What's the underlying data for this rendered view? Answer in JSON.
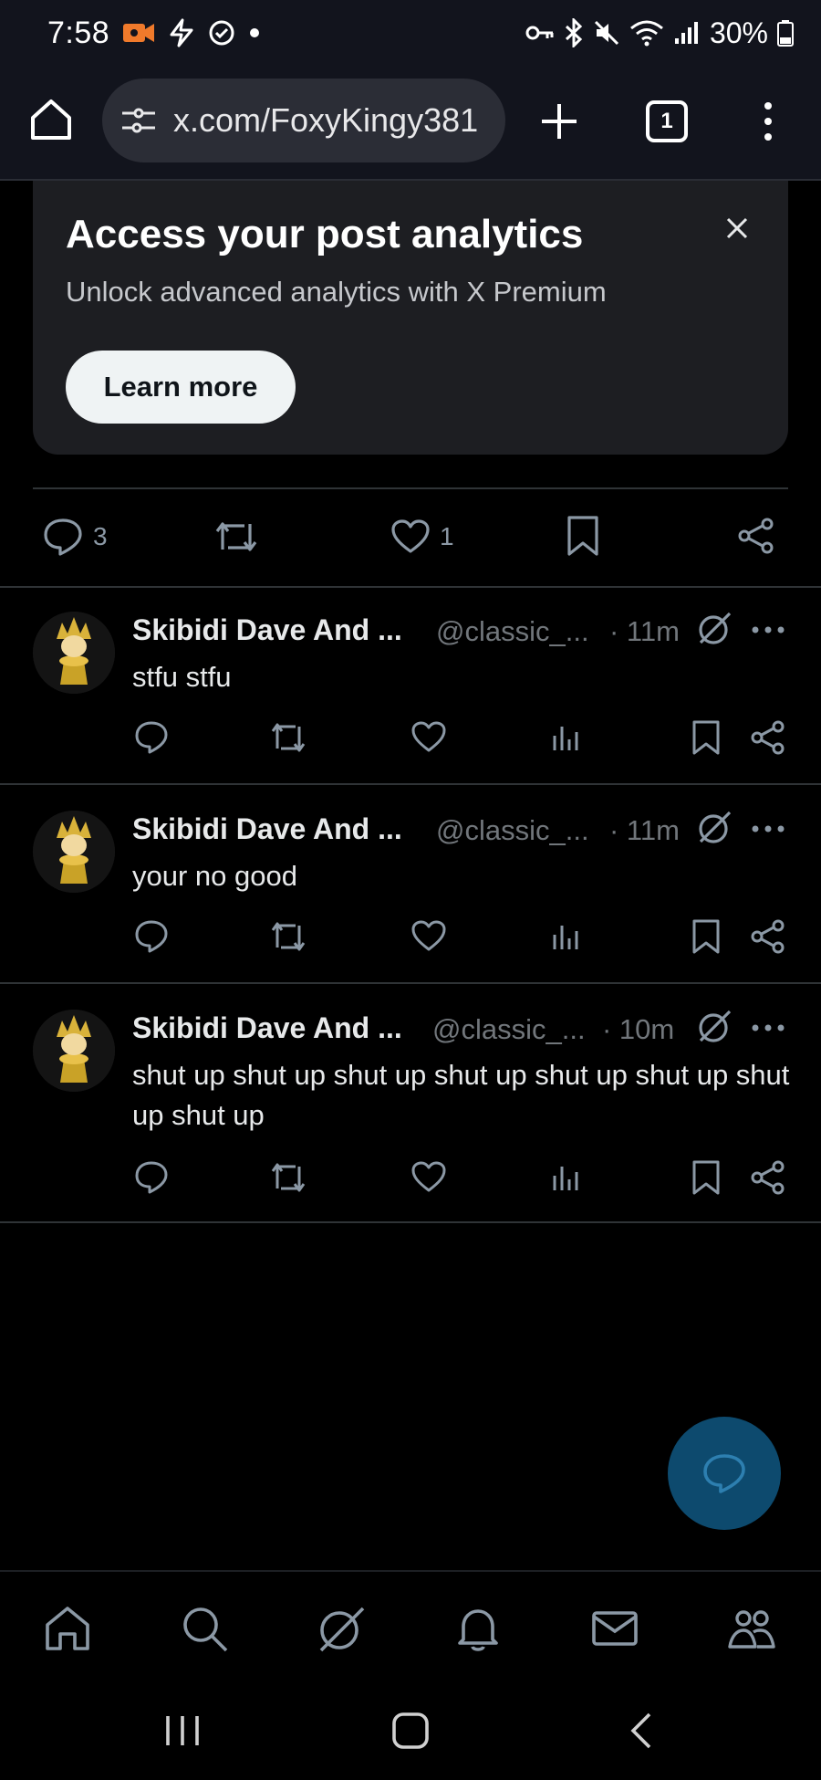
{
  "status_bar": {
    "time": "7:58",
    "battery": "30%",
    "icons": [
      "video-camera-icon",
      "bolt-icon",
      "target-icon",
      "dot-icon",
      "key-icon",
      "bluetooth-icon",
      "mute-icon",
      "wifi-icon",
      "signal-icon",
      "battery-icon"
    ],
    "accent_video": "#f07a2b"
  },
  "browser": {
    "url": "x.com/FoxyKingy381",
    "tab_count": "1"
  },
  "premium_card": {
    "title": "Access your post analytics",
    "subtitle": "Unlock advanced analytics with X Premium",
    "button_label": "Learn more"
  },
  "main_post_actions": {
    "reply_count": "3",
    "like_count": "1"
  },
  "replies": [
    {
      "name": "Skibidi Dave And ...",
      "handle": "@classic_...",
      "time": "· 11m",
      "text": "stfu stfu"
    },
    {
      "name": "Skibidi Dave And ...",
      "handle": "@classic_...",
      "time": "· 11m",
      "text": "your no good"
    },
    {
      "name": "Skibidi Dave And ...",
      "handle": "@classic_...",
      "time": "· 10m",
      "text": "shut up shut up shut up shut up shut up shut up shut up shut up"
    }
  ],
  "colors": {
    "background": "#000000",
    "card": "#1d1e22",
    "muted_text": "#71767b",
    "fab": "#0d4a6e",
    "divider": "#2f3336"
  }
}
